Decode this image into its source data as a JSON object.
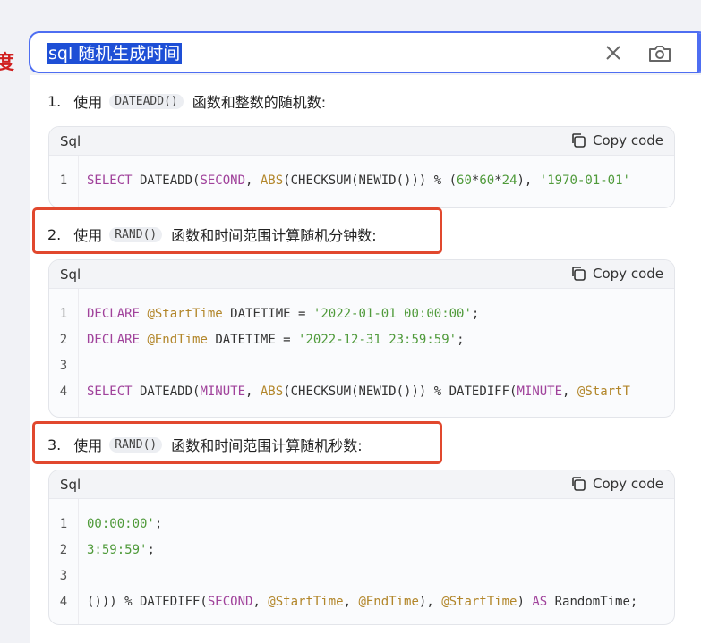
{
  "page_edge": {
    "char": "度"
  },
  "search": {
    "query": "sql 随机生成时间"
  },
  "steps": [
    {
      "number": "1.",
      "prefix": "使用",
      "func": "DATEADD()",
      "suffix": "函数和整数的随机数:"
    },
    {
      "number": "2.",
      "prefix": "使用",
      "func": "RAND()",
      "suffix": "函数和时间范围计算随机分钟数:"
    },
    {
      "number": "3.",
      "prefix": "使用",
      "func": "RAND()",
      "suffix": "函数和时间范围计算随机秒数:"
    }
  ],
  "code_blocks": [
    {
      "lang": "Sql",
      "copy_label": "Copy code",
      "lines": [
        {
          "num": "1",
          "segments": [
            {
              "t": "SELECT",
              "c": "kw"
            },
            {
              "t": " DATEADD(",
              "c": ""
            },
            {
              "t": "SECOND",
              "c": "kw"
            },
            {
              "t": ", ",
              "c": ""
            },
            {
              "t": "ABS",
              "c": "fnc"
            },
            {
              "t": "(CHECKSUM(NEWID())) % (",
              "c": ""
            },
            {
              "t": "60",
              "c": "str"
            },
            {
              "t": "*",
              "c": ""
            },
            {
              "t": "60",
              "c": "str"
            },
            {
              "t": "*",
              "c": ""
            },
            {
              "t": "24",
              "c": "str"
            },
            {
              "t": "), ",
              "c": ""
            },
            {
              "t": "'1970-01-01'",
              "c": "str"
            }
          ]
        }
      ]
    },
    {
      "lang": "Sql",
      "copy_label": "Copy code",
      "lines": [
        {
          "num": "1",
          "segments": [
            {
              "t": "DECLARE",
              "c": "kw"
            },
            {
              "t": " ",
              "c": ""
            },
            {
              "t": "@StartTime",
              "c": "var"
            },
            {
              "t": " DATETIME = ",
              "c": ""
            },
            {
              "t": "'2022-01-01 00:00:00'",
              "c": "str"
            },
            {
              "t": ";",
              "c": ""
            }
          ]
        },
        {
          "num": "2",
          "segments": [
            {
              "t": "DECLARE",
              "c": "kw"
            },
            {
              "t": " ",
              "c": ""
            },
            {
              "t": "@EndTime",
              "c": "var"
            },
            {
              "t": " DATETIME = ",
              "c": ""
            },
            {
              "t": "'2022-12-31 23:59:59'",
              "c": "str"
            },
            {
              "t": ";",
              "c": ""
            }
          ]
        },
        {
          "num": "3",
          "segments": []
        },
        {
          "num": "4",
          "segments": [
            {
              "t": "SELECT",
              "c": "kw"
            },
            {
              "t": " DATEADD(",
              "c": ""
            },
            {
              "t": "MINUTE",
              "c": "kw"
            },
            {
              "t": ", ",
              "c": ""
            },
            {
              "t": "ABS",
              "c": "fnc"
            },
            {
              "t": "(CHECKSUM(NEWID())) % DATEDIFF(",
              "c": ""
            },
            {
              "t": "MINUTE",
              "c": "kw"
            },
            {
              "t": ", ",
              "c": ""
            },
            {
              "t": "@StartT",
              "c": "var"
            }
          ]
        }
      ]
    },
    {
      "lang": "Sql",
      "copy_label": "Copy code",
      "lines": [
        {
          "num": "1",
          "segments": [
            {
              "t": " 00:00:00'",
              "c": "str"
            },
            {
              "t": ";",
              "c": ""
            }
          ]
        },
        {
          "num": "2",
          "segments": [
            {
              "t": "3:59:59'",
              "c": "str"
            },
            {
              "t": ";",
              "c": ""
            }
          ]
        },
        {
          "num": "3",
          "segments": []
        },
        {
          "num": "4",
          "segments": [
            {
              "t": "())) % DATEDIFF(",
              "c": ""
            },
            {
              "t": "SECOND",
              "c": "kw"
            },
            {
              "t": ", ",
              "c": ""
            },
            {
              "t": "@StartTime",
              "c": "var"
            },
            {
              "t": ", ",
              "c": ""
            },
            {
              "t": "@EndTime",
              "c": "var"
            },
            {
              "t": "), ",
              "c": ""
            },
            {
              "t": "@StartTime",
              "c": "var"
            },
            {
              "t": ") ",
              "c": ""
            },
            {
              "t": "AS",
              "c": "kw"
            },
            {
              "t": " RandomTime;",
              "c": ""
            }
          ]
        }
      ]
    }
  ],
  "colors": {
    "accent": "#4e6ef2",
    "highlight_box": "#e1482e",
    "keyword": "#a0429b",
    "string": "#4f9a3a",
    "variable": "#b2862a"
  },
  "icons": {
    "close": "close-icon",
    "camera": "camera-icon",
    "copy": "copy-icon"
  }
}
